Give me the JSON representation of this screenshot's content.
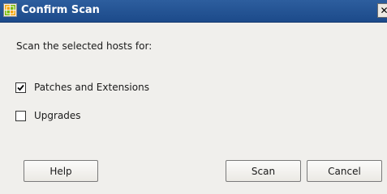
{
  "window": {
    "title": "Confirm Scan",
    "close_glyph": "✕",
    "icon": "vsphere-client-icon"
  },
  "dialog": {
    "prompt": "Scan the selected hosts for:",
    "options": [
      {
        "label": "Patches and Extensions",
        "checked": true
      },
      {
        "label": "Upgrades",
        "checked": false
      }
    ]
  },
  "buttons": {
    "help": "Help",
    "scan": "Scan",
    "cancel": "Cancel"
  },
  "colors": {
    "titlebar": "#1c4a8a",
    "dialog_background": "#f0efec"
  }
}
